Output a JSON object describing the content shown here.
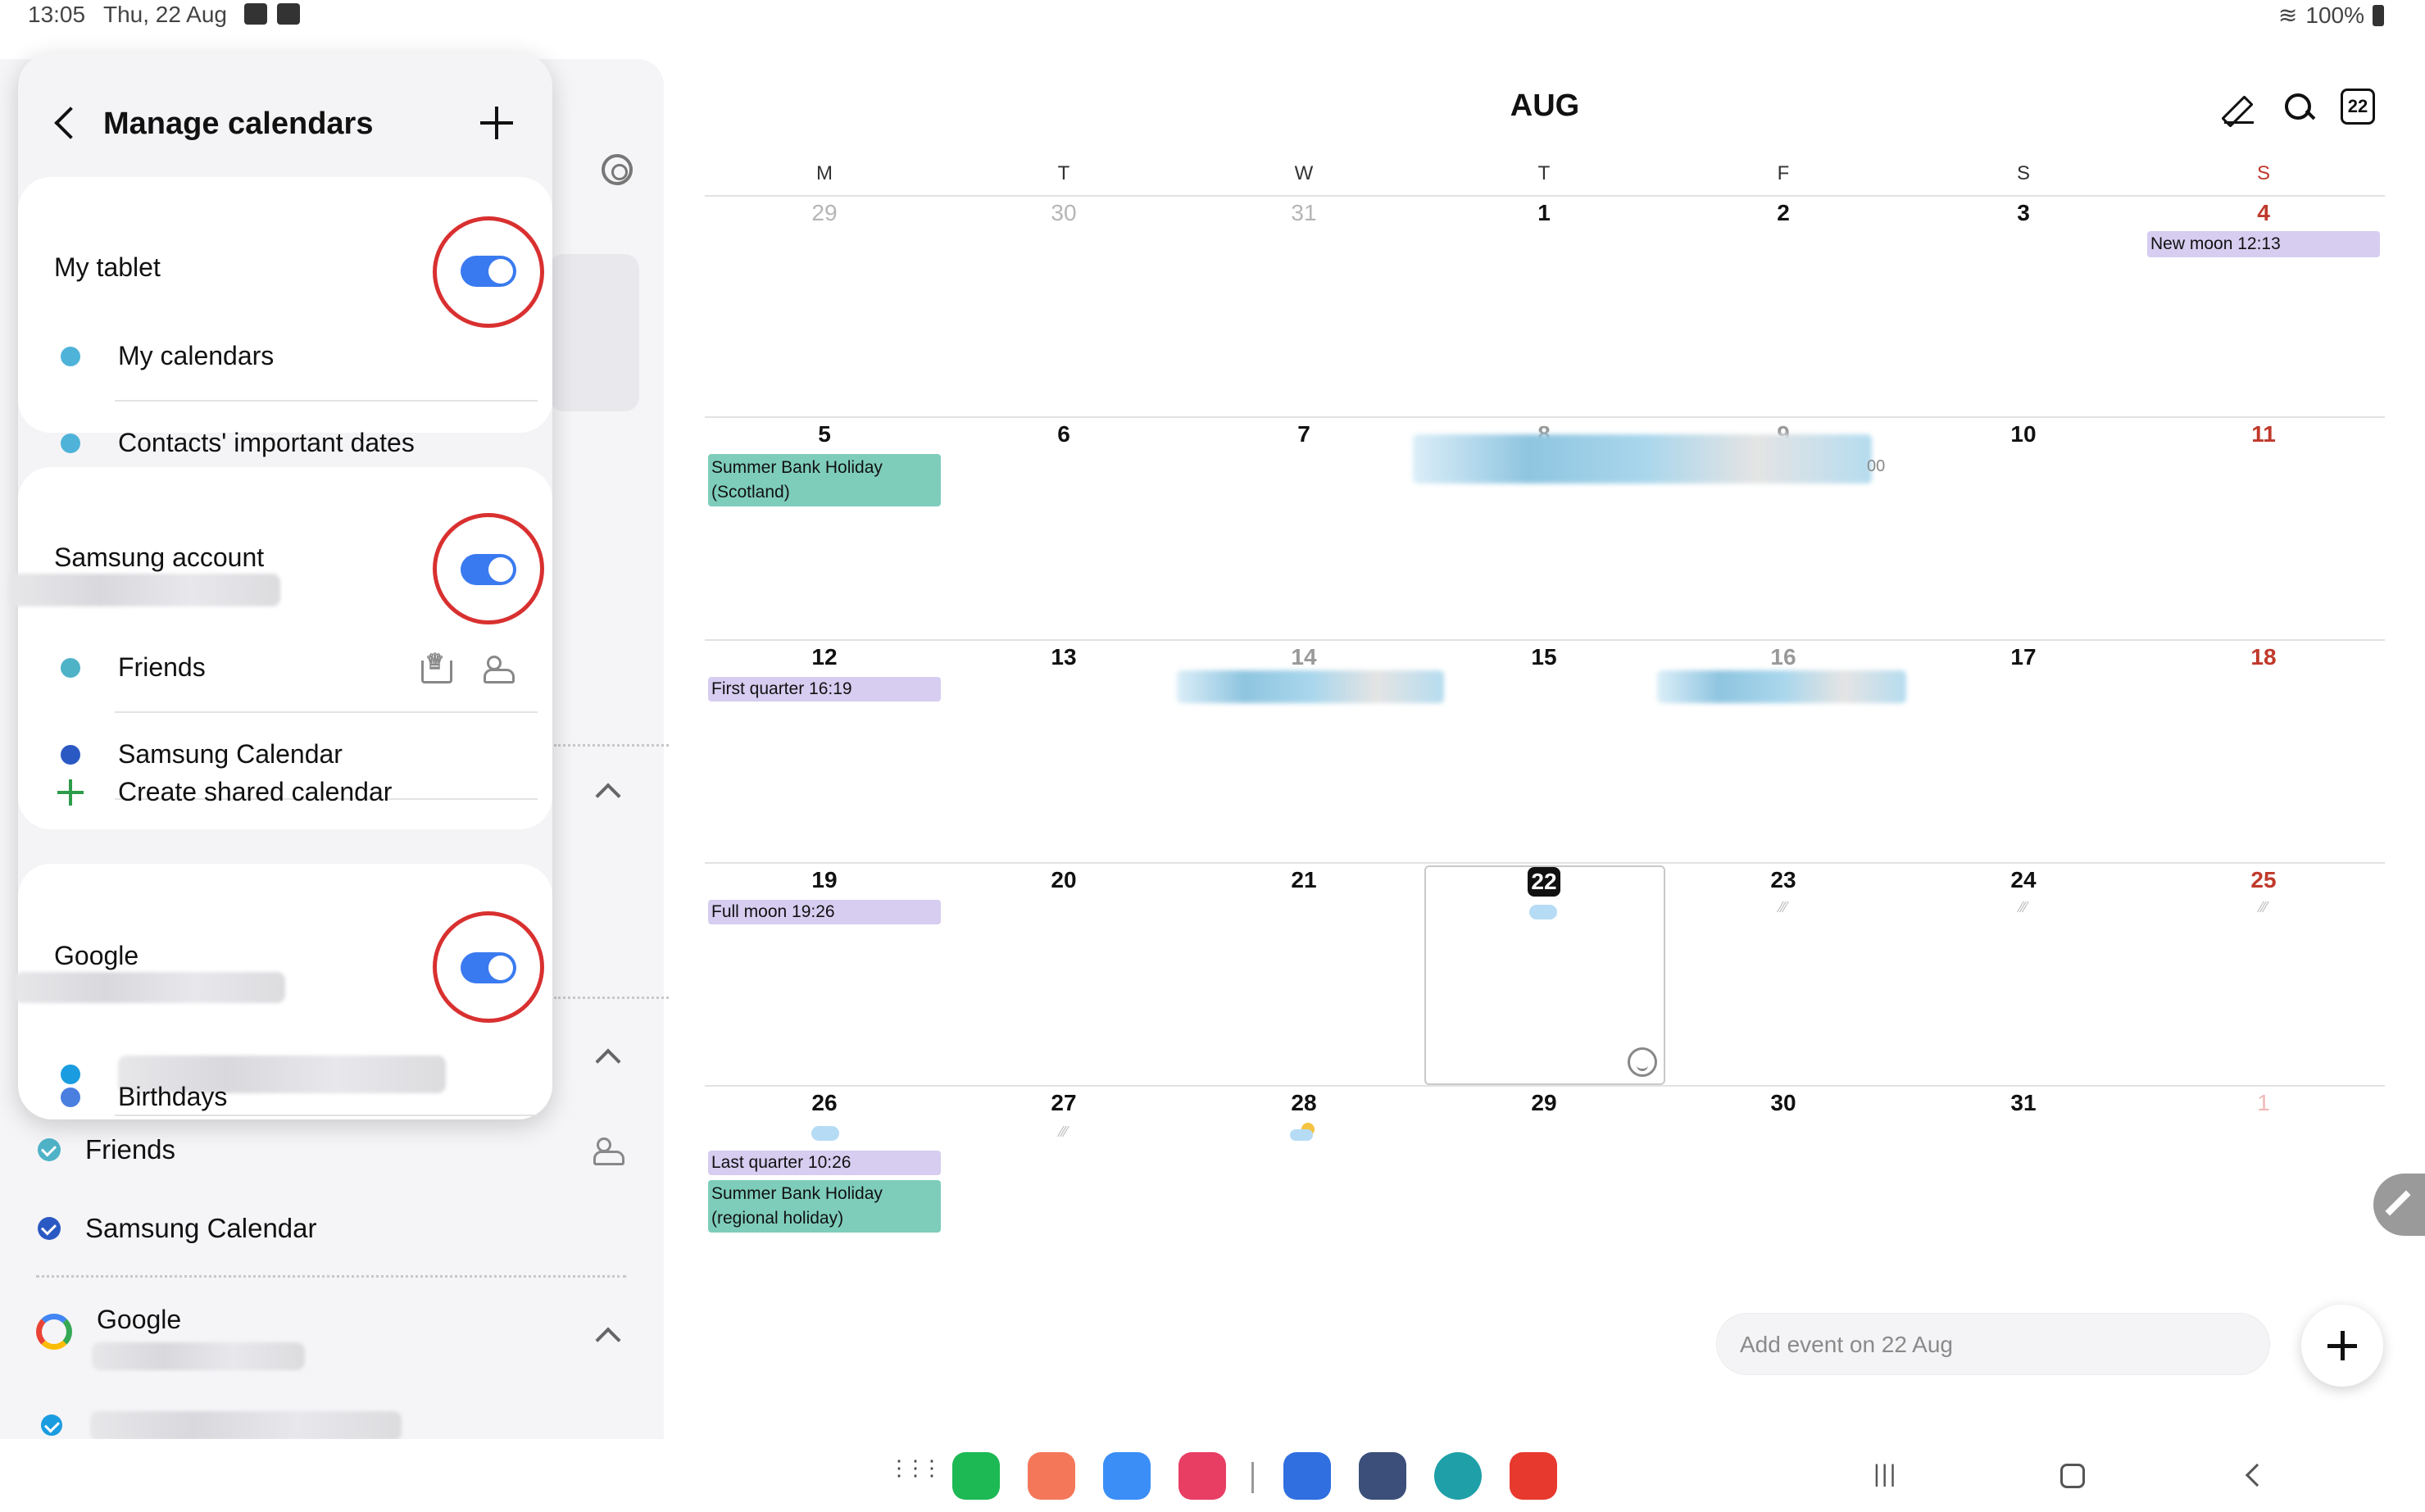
{
  "status_bar": {
    "time": "13:05",
    "date": "Thu, 22 Aug",
    "battery": "100%"
  },
  "drawer": {
    "items": [
      {
        "label": "Friends",
        "color": "#4fb3c8"
      },
      {
        "label": "Samsung Calendar",
        "color": "#2b59c3"
      }
    ],
    "google_label": "Google"
  },
  "manage_calendars": {
    "title": "Manage calendars",
    "groups": [
      {
        "title": "My tablet",
        "toggle_on": true,
        "items": [
          {
            "label": "My calendars",
            "color": "#4fb3d9"
          },
          {
            "label": "Contacts' important dates",
            "color": "#4fb3d9"
          }
        ]
      },
      {
        "title": "Samsung account",
        "toggle_on": true,
        "items": [
          {
            "label": "Friends",
            "color": "#4fb3c8"
          },
          {
            "label": "Samsung Calendar",
            "color": "#2b59c3"
          },
          {
            "label": "Create shared calendar",
            "color": "#2e9c4a"
          }
        ]
      },
      {
        "title": "Google",
        "toggle_on": true,
        "items": [
          {
            "label": "",
            "color": "#1a9ce0"
          },
          {
            "label": "Birthdays",
            "color": "#4a7fe0"
          }
        ]
      }
    ]
  },
  "calendar": {
    "month": "AUG",
    "today_icon": "22",
    "weekdays": [
      "M",
      "T",
      "W",
      "T",
      "F",
      "S",
      "S"
    ],
    "weeks": [
      [
        "29",
        "30",
        "31",
        "1",
        "2",
        "3",
        "4"
      ],
      [
        "5",
        "6",
        "7",
        "8",
        "9",
        "10",
        "11"
      ],
      [
        "12",
        "13",
        "14",
        "15",
        "16",
        "17",
        "18"
      ],
      [
        "19",
        "20",
        "21",
        "22",
        "23",
        "24",
        "25"
      ],
      [
        "26",
        "27",
        "28",
        "29",
        "30",
        "31",
        "1"
      ]
    ],
    "events": {
      "new_moon": "New moon 12:13",
      "bank_holiday_scotland": "Summer Bank Holiday (Scotland)",
      "first_quarter": "First quarter 16:19",
      "full_moon": "Full moon 19:26",
      "last_quarter": "Last quarter 10:26",
      "bank_holiday_regional": "Summer Bank Holiday (regional holiday)",
      "time_fragment": "00"
    },
    "add_event_placeholder": "Add event on 22 Aug"
  },
  "colors": {
    "toggle": "#3a7af0",
    "highlight_ring": "#d93030",
    "event_purple": "#d6cdf0",
    "event_green": "#7ecdbb",
    "sunday": "#c0392b"
  },
  "taskbar": {
    "apps": [
      {
        "name": "phone-app-icon",
        "color": "#1db954"
      },
      {
        "name": "contacts-app-icon",
        "color": "#f4775a"
      },
      {
        "name": "messages-app-icon",
        "color": "#3a8ef6"
      },
      {
        "name": "camera-app-icon",
        "color": "#e83e64"
      },
      {
        "name": "m-app-icon",
        "color": "#2f6fe0"
      },
      {
        "name": "settings-app-icon",
        "color": "#3b4f7a"
      },
      {
        "name": "edge-app-icon",
        "color": "#1fa0a8"
      },
      {
        "name": "red-app-icon",
        "color": "#e8392e"
      }
    ]
  }
}
